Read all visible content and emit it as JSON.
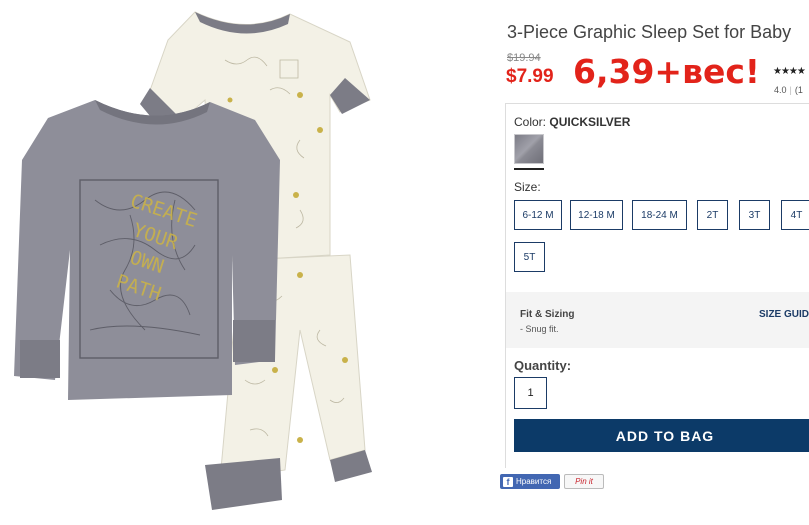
{
  "product": {
    "title": "3-Piece Graphic Sleep Set for Baby",
    "old_price": "$19.94",
    "sale_price": "$7.99",
    "annotation": "6,39+вес!",
    "stars": "★★★★",
    "rating_value": "4.0",
    "rating_sep": "|",
    "rating_count": "(1",
    "image_graphic_text": [
      "CREATE",
      "YOUR",
      "OWN",
      "PATH"
    ]
  },
  "color": {
    "label": "Color:",
    "value": "QUICKSILVER"
  },
  "size": {
    "label": "Size:",
    "options": [
      "6-12 M",
      "12-18 M",
      "18-24 M",
      "2T",
      "3T",
      "4T",
      "5T"
    ]
  },
  "fit": {
    "title": "Fit & Sizing",
    "note": "- Snug fit.",
    "size_guide": "SIZE GUID"
  },
  "quantity": {
    "label": "Quantity:",
    "value": "1"
  },
  "actions": {
    "add_to_bag": "ADD TO BAG"
  },
  "social": {
    "fb_label": "Нравится",
    "fb_icon": "f",
    "pin_label": "Pin it"
  },
  "colors": {
    "accent_navy": "#0c3a68",
    "sale_red": "#e2231a",
    "shirt_gray": "#8e8e99",
    "print_yellow": "#c9b24a"
  }
}
